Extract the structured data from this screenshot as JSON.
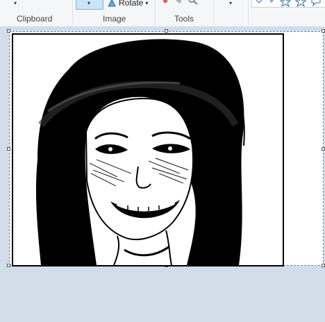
{
  "ribbon": {
    "groups": [
      {
        "label": "Clipboard"
      },
      {
        "label": "Image"
      },
      {
        "label": "Tools"
      }
    ],
    "rotate_label": "Rotate",
    "dropdown_glyph": "▾"
  },
  "canvas": {
    "background": "#d3dce9",
    "selection_color": "#4a8ad4"
  }
}
